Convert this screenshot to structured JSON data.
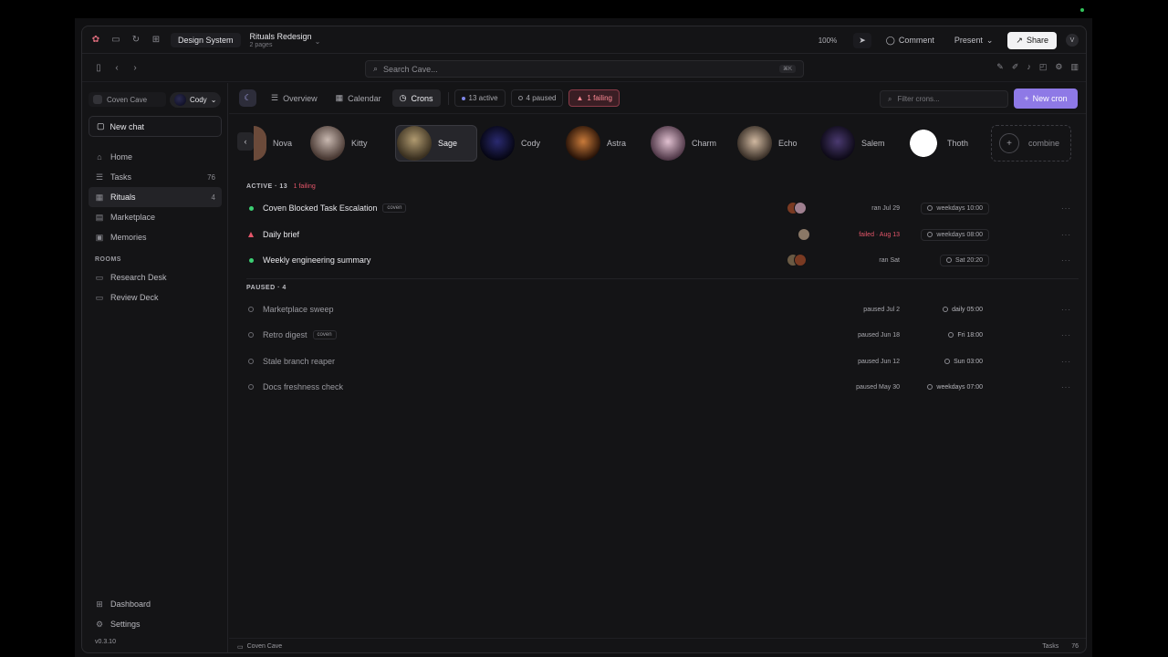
{
  "titlebar": {
    "workspace": "Design System",
    "file_title": "Rituals Redesign",
    "file_pages": "2 pages",
    "zoom": "100%",
    "comment": "Comment",
    "present": "Present",
    "share": "Share",
    "avatar_initial": "V"
  },
  "toolbar": {
    "search_placeholder": "Search Cave...",
    "search_shortcut": "⌘K"
  },
  "sidebar": {
    "workspace_name": "Coven Cave",
    "user_name": "Cody",
    "new_chat": "New chat",
    "nav": [
      {
        "label": "Home",
        "count": ""
      },
      {
        "label": "Tasks",
        "count": "76"
      },
      {
        "label": "Rituals",
        "count": "4"
      },
      {
        "label": "Marketplace",
        "count": ""
      },
      {
        "label": "Memories",
        "count": ""
      }
    ],
    "rooms_label": "ROOMS",
    "rooms": [
      {
        "label": "Research Desk"
      },
      {
        "label": "Review Deck"
      }
    ],
    "bottom": [
      {
        "label": "Dashboard"
      },
      {
        "label": "Settings"
      }
    ],
    "version": "v0.3.10"
  },
  "main": {
    "tabs": [
      {
        "label": "Overview"
      },
      {
        "label": "Calendar"
      },
      {
        "label": "Crons"
      }
    ],
    "stats": {
      "active": "13 active",
      "paused": "4 paused",
      "failing": "1 failing"
    },
    "filter_placeholder": "Filter crons...",
    "new_cron": "New cron",
    "agents": [
      {
        "name": "Nova",
        "color": "#6b4a3a"
      },
      {
        "name": "Kitty",
        "color": "#8a7a74"
      },
      {
        "name": "Sage",
        "color": "#6a5a44"
      },
      {
        "name": "Cody",
        "color": "#1c1a3e"
      },
      {
        "name": "Astra",
        "color": "#7a3a22"
      },
      {
        "name": "Charm",
        "color": "#a08090"
      },
      {
        "name": "Echo",
        "color": "#8a7866"
      },
      {
        "name": "Salem",
        "color": "#251f38"
      },
      {
        "name": "Thoth",
        "color": "#f0f0f0"
      }
    ],
    "combine": "combine",
    "active_section": {
      "label": "ACTIVE · 13",
      "failing": "1 failing",
      "rows": [
        {
          "name": "Coven Blocked Task Escalation",
          "tag": "coven",
          "status": "ok",
          "meta": "ran Jul 29",
          "schedule": "weekdays 10:00"
        },
        {
          "name": "Daily brief",
          "tag": "",
          "status": "failed",
          "meta": "failed · Aug 13",
          "schedule": "weekdays 08:00"
        },
        {
          "name": "Weekly engineering summary",
          "tag": "",
          "status": "ok",
          "meta": "ran Sat",
          "schedule": "Sat 20:20"
        }
      ]
    },
    "paused_section": {
      "label": "PAUSED · 4",
      "rows": [
        {
          "name": "Marketplace sweep",
          "tag": "",
          "meta": "paused Jul 2",
          "schedule": "daily 05:00"
        },
        {
          "name": "Retro digest",
          "tag": "coven",
          "meta": "paused Jun 18",
          "schedule": "Fri 18:00"
        },
        {
          "name": "Stale branch reaper",
          "tag": "",
          "meta": "paused Jun 12",
          "schedule": "Sun 03:00"
        },
        {
          "name": "Docs freshness check",
          "tag": "",
          "meta": "paused May 30",
          "schedule": "weekdays 07:00"
        }
      ]
    }
  },
  "statusbar": {
    "location": "Coven Cave",
    "tasks_label": "Tasks",
    "tasks_count": "76"
  },
  "colors": {
    "accent": "#8e79e6",
    "ok": "#3ccf73",
    "fail": "#e5566a"
  }
}
